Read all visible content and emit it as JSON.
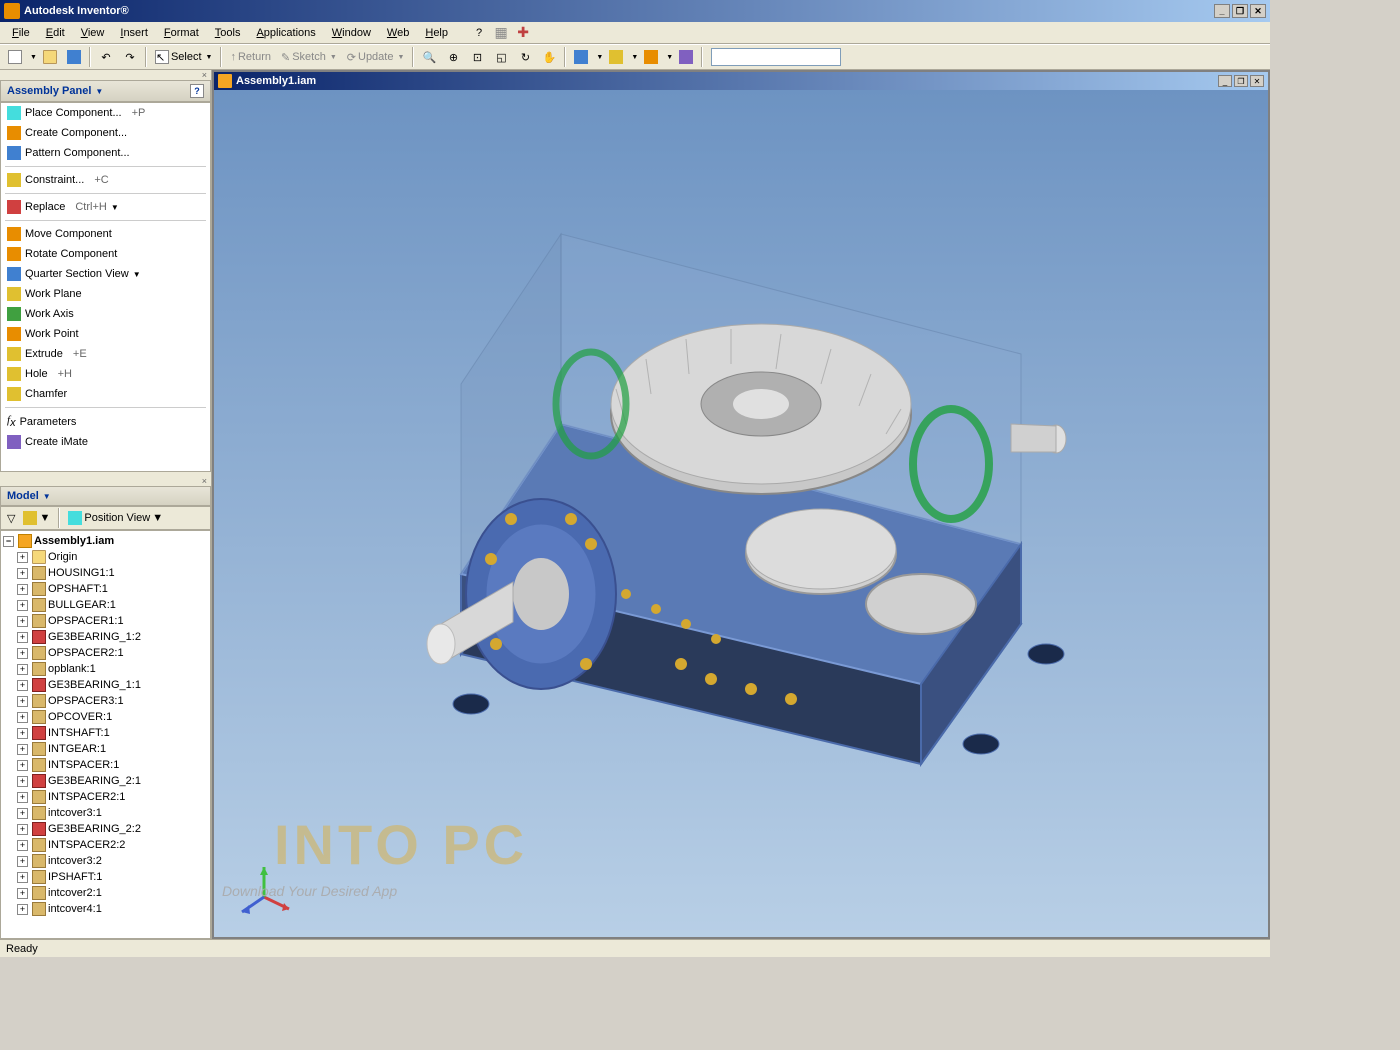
{
  "app": {
    "title": "Autodesk Inventor®"
  },
  "menu": [
    "File",
    "Edit",
    "View",
    "Insert",
    "Format",
    "Tools",
    "Applications",
    "Window",
    "Web",
    "Help"
  ],
  "toolbar2": {
    "select": "Select",
    "return": "Return",
    "sketch": "Sketch",
    "update": "Update"
  },
  "panel": {
    "title": "Assembly Panel",
    "items": [
      {
        "label": "Place Component...",
        "shortcut": "+P",
        "icon": "c-cyan"
      },
      {
        "label": "Create Component...",
        "shortcut": "",
        "icon": "c-orng"
      },
      {
        "label": "Pattern Component...",
        "shortcut": "",
        "icon": "c-blue"
      },
      {
        "label": "Constraint...",
        "shortcut": "+C",
        "icon": "c-yel",
        "sep": true
      },
      {
        "label": "Replace",
        "shortcut": "Ctrl+H",
        "icon": "c-red",
        "drop": true,
        "sep": true
      },
      {
        "label": "Move Component",
        "shortcut": "",
        "icon": "c-orng",
        "sep": true
      },
      {
        "label": "Rotate Component",
        "shortcut": "",
        "icon": "c-orng"
      },
      {
        "label": "Quarter Section View",
        "shortcut": "",
        "icon": "c-blue",
        "drop": true
      },
      {
        "label": "Work Plane",
        "shortcut": "",
        "icon": "c-yel"
      },
      {
        "label": "Work Axis",
        "shortcut": "",
        "icon": "c-grn"
      },
      {
        "label": "Work Point",
        "shortcut": "",
        "icon": "c-orng"
      },
      {
        "label": "Extrude",
        "shortcut": "+E",
        "icon": "c-yel"
      },
      {
        "label": "Hole",
        "shortcut": "+H",
        "icon": "c-yel"
      },
      {
        "label": "Chamfer",
        "shortcut": "",
        "icon": "c-yel"
      },
      {
        "label": "Parameters",
        "shortcut": "",
        "icon": "c-gry",
        "sep": true,
        "italic": true
      },
      {
        "label": "Create iMate",
        "shortcut": "",
        "icon": "c-prp"
      }
    ]
  },
  "model": {
    "title": "Model",
    "subtoolbar": "Position View",
    "root": "Assembly1.iam",
    "items": [
      {
        "label": "Origin",
        "icon": "ico-folder"
      },
      {
        "label": "HOUSING1:1",
        "icon": "ico-box"
      },
      {
        "label": "OPSHAFT:1",
        "icon": "ico-box"
      },
      {
        "label": "BULLGEAR:1",
        "icon": "ico-box"
      },
      {
        "label": "OPSPACER1:1",
        "icon": "ico-box"
      },
      {
        "label": "GE3BEARING_1:2",
        "icon": "ico-red"
      },
      {
        "label": "OPSPACER2:1",
        "icon": "ico-box"
      },
      {
        "label": "opblank:1",
        "icon": "ico-box"
      },
      {
        "label": "GE3BEARING_1:1",
        "icon": "ico-red"
      },
      {
        "label": "OPSPACER3:1",
        "icon": "ico-box"
      },
      {
        "label": "OPCOVER:1",
        "icon": "ico-box"
      },
      {
        "label": "INTSHAFT:1",
        "icon": "ico-red"
      },
      {
        "label": "INTGEAR:1",
        "icon": "ico-box"
      },
      {
        "label": "INTSPACER:1",
        "icon": "ico-box"
      },
      {
        "label": "GE3BEARING_2:1",
        "icon": "ico-red"
      },
      {
        "label": "INTSPACER2:1",
        "icon": "ico-box"
      },
      {
        "label": "intcover3:1",
        "icon": "ico-box"
      },
      {
        "label": "GE3BEARING_2:2",
        "icon": "ico-red"
      },
      {
        "label": "INTSPACER2:2",
        "icon": "ico-box"
      },
      {
        "label": "intcover3:2",
        "icon": "ico-box"
      },
      {
        "label": "IPSHAFT:1",
        "icon": "ico-box"
      },
      {
        "label": "intcover2:1",
        "icon": "ico-box"
      },
      {
        "label": "intcover4:1",
        "icon": "ico-box"
      }
    ]
  },
  "viewport": {
    "title": "Assembly1.iam"
  },
  "watermark": {
    "main": "INTO PC",
    "sub": "Download Your Desired App"
  },
  "status": "Ready"
}
